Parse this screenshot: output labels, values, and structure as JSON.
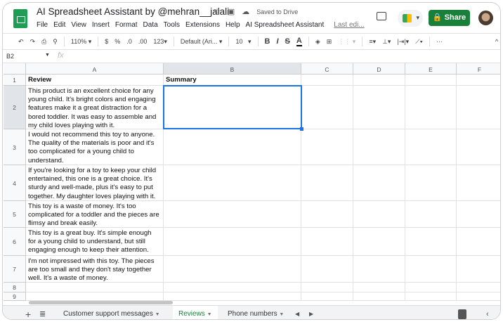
{
  "title": "AI Spreadsheet Assistant by @mehran__jalali",
  "saved": "Saved to Drive",
  "menu": [
    "File",
    "Edit",
    "View",
    "Insert",
    "Format",
    "Data",
    "Tools",
    "Extensions",
    "Help",
    "AI Spreadsheet Assistant"
  ],
  "last_edit": "Last edi...",
  "share_label": "Share",
  "toolbar": {
    "zoom": "110%",
    "currency": "$",
    "percent": "%",
    "dec_less": ".0",
    "dec_more": ".00",
    "format": "123",
    "font": "Default (Ari...",
    "size": "10",
    "more": "···"
  },
  "name_box": "B2",
  "fx": "fx",
  "columns": [
    "A",
    "B",
    "C",
    "D",
    "E",
    "F"
  ],
  "rows": [
    {
      "n": "1",
      "a": "Review",
      "b": "Summary"
    },
    {
      "n": "2",
      "a": "This product is an excellent choice for any young child. It's bright colors and engaging features make it a great distraction for a bored toddler. It was easy to assemble and my child loves playing with it.",
      "b": ""
    },
    {
      "n": "3",
      "a": "I would not recommend this toy to anyone. The quality of the materials is poor and it's too complicated for a young child to understand.",
      "b": ""
    },
    {
      "n": "4",
      "a": "If you're looking for a toy to keep your child entertained, this one is a great choice. It's sturdy and well-made, plus it's easy to put together. My daughter loves playing with it.",
      "b": ""
    },
    {
      "n": "5",
      "a": "This toy is a waste of money. It's too complicated for a toddler and the pieces are flimsy and break easily.",
      "b": ""
    },
    {
      "n": "6",
      "a": "This toy is a great buy. It's simple enough for a young child to understand, but still engaging enough to keep their attention.",
      "b": ""
    },
    {
      "n": "7",
      "a": "I'm not impressed with this toy. The pieces are too small and they don't stay together well. It's a waste of money.",
      "b": ""
    },
    {
      "n": "8",
      "a": "",
      "b": ""
    },
    {
      "n": "9",
      "a": "",
      "b": ""
    }
  ],
  "selected_cell": "B2",
  "sheets": [
    {
      "label": "Customer support messages",
      "active": false
    },
    {
      "label": "Reviews",
      "active": true
    },
    {
      "label": "Phone numbers",
      "active": false
    }
  ],
  "colors": {
    "accent": "#188038",
    "selection": "#1a73e8"
  }
}
